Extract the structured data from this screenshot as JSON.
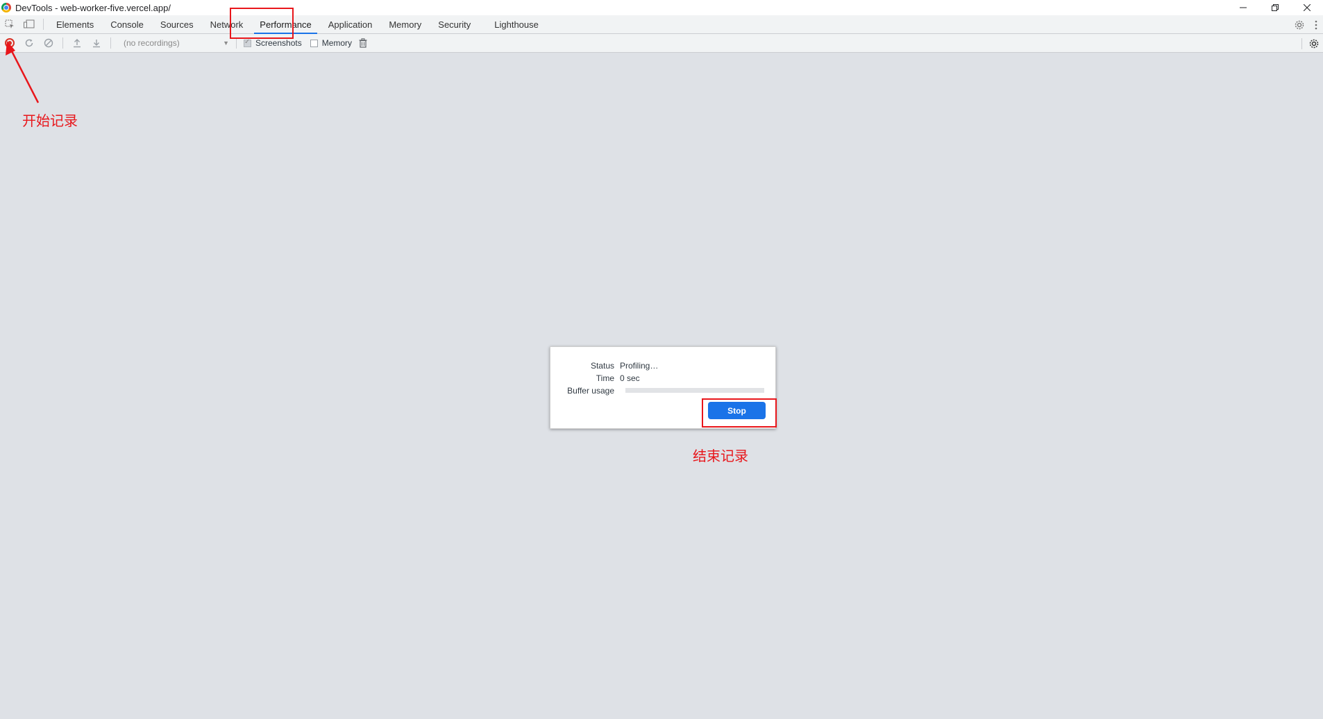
{
  "window": {
    "title": "DevTools - web-worker-five.vercel.app/",
    "controls": [
      "minimize-icon",
      "restore-icon",
      "close-icon"
    ]
  },
  "tabs": [
    {
      "label": "Elements",
      "active": false
    },
    {
      "label": "Console",
      "active": false
    },
    {
      "label": "Sources",
      "active": false
    },
    {
      "label": "Network",
      "active": false
    },
    {
      "label": "Performance",
      "active": true
    },
    {
      "label": "Application",
      "active": false
    },
    {
      "label": "Memory",
      "active": false
    },
    {
      "label": "Security",
      "active": false
    },
    {
      "label": "Lighthouse",
      "active": false
    }
  ],
  "toolbar": {
    "recordings_select": "(no recordings)",
    "screenshots_label": "Screenshots",
    "screenshots_checked": true,
    "memory_label": "Memory",
    "memory_checked": false
  },
  "dialog": {
    "status_label": "Status",
    "status_value": "Profiling…",
    "time_label": "Time",
    "time_value": "0 sec",
    "buffer_label": "Buffer usage",
    "buffer_fraction": 0,
    "stop_label": "Stop"
  },
  "annotations": {
    "start_recording": "开始记录",
    "stop_recording": "结束记录",
    "color": "#e8161b"
  },
  "colors": {
    "accent": "#1a73e8",
    "record": "#d93025",
    "background": "#dee1e6"
  }
}
